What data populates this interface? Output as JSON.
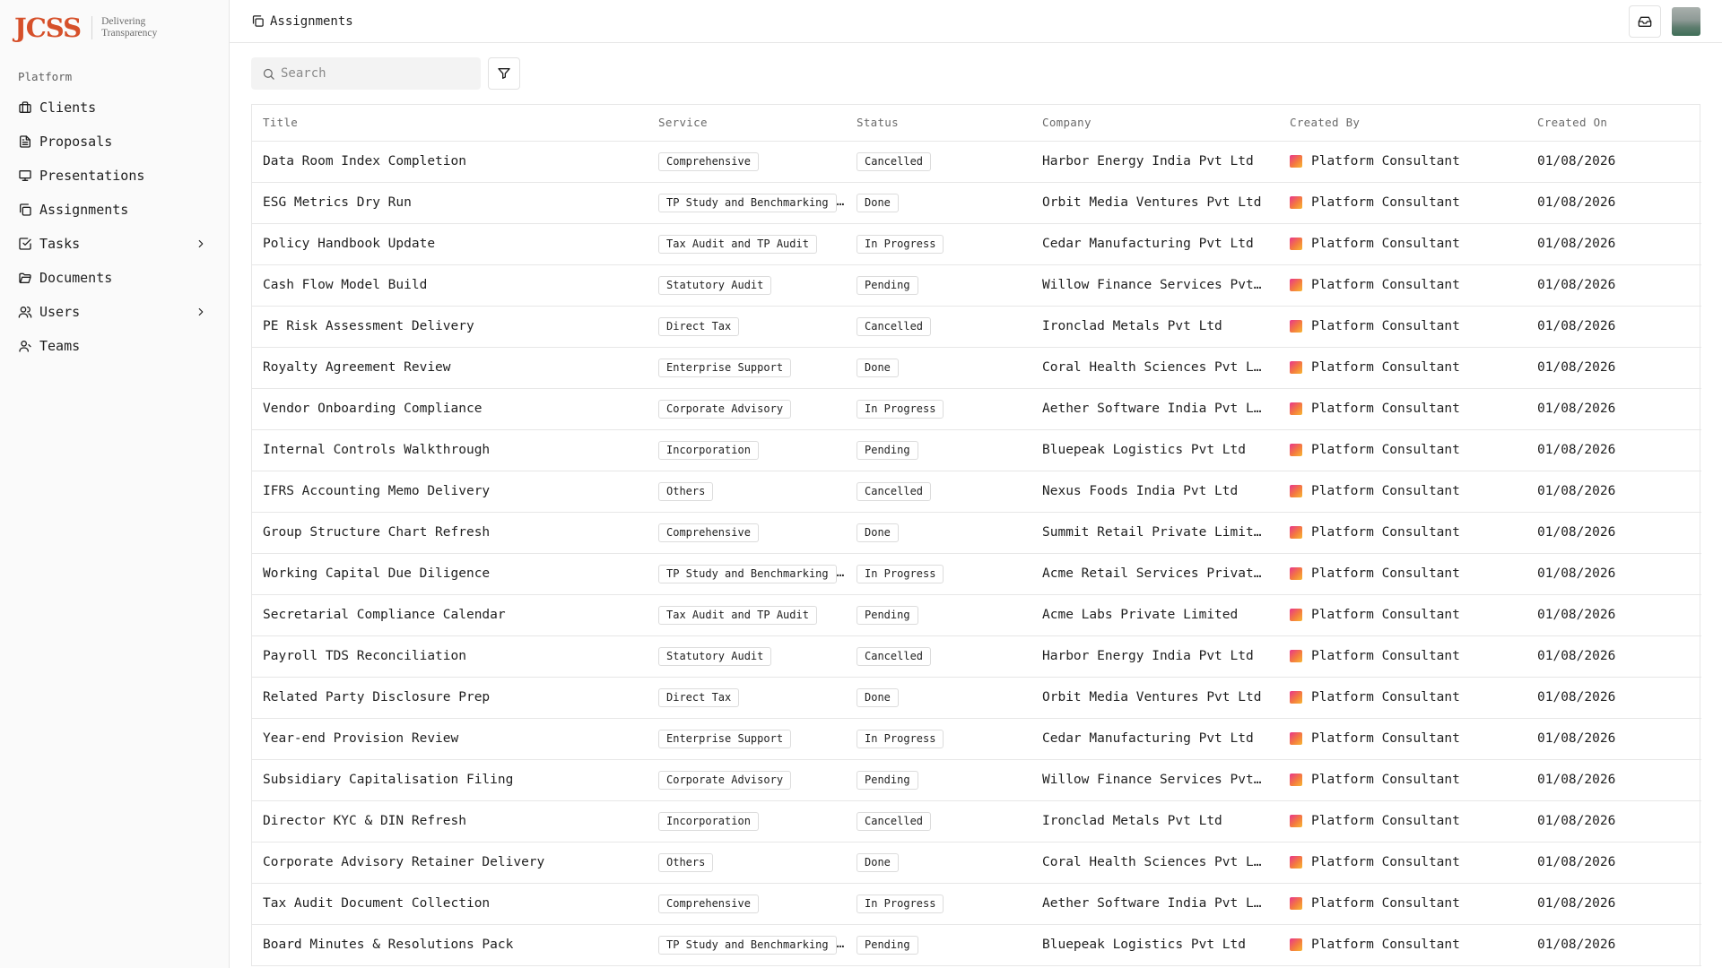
{
  "brand": {
    "logo": "JCSS",
    "tagline_line1": "Delivering",
    "tagline_line2": "Transparency"
  },
  "sidebar": {
    "section_label": "Platform",
    "items": [
      {
        "label": "Clients",
        "icon": "briefcase-icon"
      },
      {
        "label": "Proposals",
        "icon": "file-text-icon"
      },
      {
        "label": "Presentations",
        "icon": "presentation-icon"
      },
      {
        "label": "Assignments",
        "icon": "copy-icon"
      },
      {
        "label": "Tasks",
        "icon": "check-square-icon",
        "has_submenu": true
      },
      {
        "label": "Documents",
        "icon": "folder-open-icon"
      },
      {
        "label": "Users",
        "icon": "users-icon",
        "has_submenu": true
      },
      {
        "label": "Teams",
        "icon": "teams-icon"
      }
    ]
  },
  "topbar": {
    "breadcrumb": "Assignments"
  },
  "toolbar": {
    "search_placeholder": "Search"
  },
  "table": {
    "columns": [
      "Title",
      "Service",
      "Status",
      "Company",
      "Created By",
      "Created On"
    ],
    "rows": [
      {
        "title": "Data Room Index Completion",
        "service": "Comprehensive",
        "status": "Cancelled",
        "company": "Harbor Energy India Pvt Ltd",
        "created_by": "Platform Consultant",
        "created_on": "01/08/2026"
      },
      {
        "title": "ESG Metrics Dry Run",
        "service": "TP Study and Benchmarking",
        "status": "Done",
        "company": "Orbit Media Ventures Pvt Ltd",
        "created_by": "Platform Consultant",
        "created_on": "01/08/2026"
      },
      {
        "title": "Policy Handbook Update",
        "service": "Tax Audit and TP Audit",
        "status": "In Progress",
        "company": "Cedar Manufacturing Pvt Ltd",
        "created_by": "Platform Consultant",
        "created_on": "01/08/2026"
      },
      {
        "title": "Cash Flow Model Build",
        "service": "Statutory Audit",
        "status": "Pending",
        "company": "Willow Finance Services Pvt Ltd",
        "created_by": "Platform Consultant",
        "created_on": "01/08/2026"
      },
      {
        "title": "PE Risk Assessment Delivery",
        "service": "Direct Tax",
        "status": "Cancelled",
        "company": "Ironclad Metals Pvt Ltd",
        "created_by": "Platform Consultant",
        "created_on": "01/08/2026"
      },
      {
        "title": "Royalty Agreement Review",
        "service": "Enterprise Support",
        "status": "Done",
        "company": "Coral Health Sciences Pvt Ltd",
        "created_by": "Platform Consultant",
        "created_on": "01/08/2026"
      },
      {
        "title": "Vendor Onboarding Compliance",
        "service": "Corporate Advisory",
        "status": "In Progress",
        "company": "Aether Software India Pvt Ltd",
        "created_by": "Platform Consultant",
        "created_on": "01/08/2026"
      },
      {
        "title": "Internal Controls Walkthrough",
        "service": "Incorporation",
        "status": "Pending",
        "company": "Bluepeak Logistics Pvt Ltd",
        "created_by": "Platform Consultant",
        "created_on": "01/08/2026"
      },
      {
        "title": "IFRS Accounting Memo Delivery",
        "service": "Others",
        "status": "Cancelled",
        "company": "Nexus Foods India Pvt Ltd",
        "created_by": "Platform Consultant",
        "created_on": "01/08/2026"
      },
      {
        "title": "Group Structure Chart Refresh",
        "service": "Comprehensive",
        "status": "Done",
        "company": "Summit Retail Private Limited",
        "created_by": "Platform Consultant",
        "created_on": "01/08/2026"
      },
      {
        "title": "Working Capital Due Diligence",
        "service": "TP Study and Benchmarking",
        "status": "In Progress",
        "company": "Acme Retail Services Private Limited",
        "created_by": "Platform Consultant",
        "created_on": "01/08/2026"
      },
      {
        "title": "Secretarial Compliance Calendar",
        "service": "Tax Audit and TP Audit",
        "status": "Pending",
        "company": "Acme Labs Private Limited",
        "created_by": "Platform Consultant",
        "created_on": "01/08/2026"
      },
      {
        "title": "Payroll TDS Reconciliation",
        "service": "Statutory Audit",
        "status": "Cancelled",
        "company": "Harbor Energy India Pvt Ltd",
        "created_by": "Platform Consultant",
        "created_on": "01/08/2026"
      },
      {
        "title": "Related Party Disclosure Prep",
        "service": "Direct Tax",
        "status": "Done",
        "company": "Orbit Media Ventures Pvt Ltd",
        "created_by": "Platform Consultant",
        "created_on": "01/08/2026"
      },
      {
        "title": "Year-end Provision Review",
        "service": "Enterprise Support",
        "status": "In Progress",
        "company": "Cedar Manufacturing Pvt Ltd",
        "created_by": "Platform Consultant",
        "created_on": "01/08/2026"
      },
      {
        "title": "Subsidiary Capitalisation Filing",
        "service": "Corporate Advisory",
        "status": "Pending",
        "company": "Willow Finance Services Pvt Ltd",
        "created_by": "Platform Consultant",
        "created_on": "01/08/2026"
      },
      {
        "title": "Director KYC & DIN Refresh",
        "service": "Incorporation",
        "status": "Cancelled",
        "company": "Ironclad Metals Pvt Ltd",
        "created_by": "Platform Consultant",
        "created_on": "01/08/2026"
      },
      {
        "title": "Corporate Advisory Retainer Delivery",
        "service": "Others",
        "status": "Done",
        "company": "Coral Health Sciences Pvt Ltd",
        "created_by": "Platform Consultant",
        "created_on": "01/08/2026"
      },
      {
        "title": "Tax Audit Document Collection",
        "service": "Comprehensive",
        "status": "In Progress",
        "company": "Aether Software India Pvt Ltd",
        "created_by": "Platform Consultant",
        "created_on": "01/08/2026"
      },
      {
        "title": "Board Minutes & Resolutions Pack",
        "service": "TP Study and Benchmarking",
        "status": "Pending",
        "company": "Bluepeak Logistics Pvt Ltd",
        "created_by": "Platform Consultant",
        "created_on": "01/08/2026"
      }
    ]
  },
  "colors": {
    "brand": "#d6502a",
    "border": "#e7e7e7",
    "sidebar_bg": "#fafafa"
  }
}
